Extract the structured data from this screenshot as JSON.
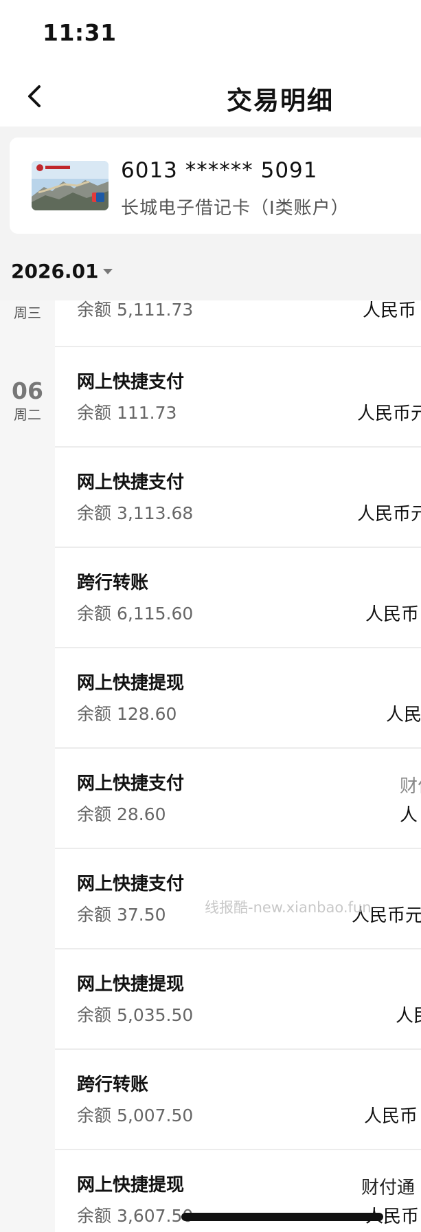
{
  "status_bar": {
    "time": "11:31"
  },
  "nav": {
    "title": "交易明细",
    "back_icon": "chevron-left-icon"
  },
  "account": {
    "card_number": "6013 ****** 5091",
    "card_desc": "长城电子借记卡（I类账户）",
    "card_image": "bank-card-thumbnail"
  },
  "filter": {
    "month": "2026.01"
  },
  "days": [
    {
      "weekday": "周三"
    },
    {
      "day": "06",
      "weekday": "周二"
    }
  ],
  "transactions": [
    {
      "title": "",
      "balance_label": "余额",
      "balance": "5,111.73",
      "right": "人民币"
    },
    {
      "title": "网上快捷支付",
      "balance_label": "余额",
      "balance": "111.73",
      "right": "人民币元"
    },
    {
      "title": "网上快捷支付",
      "balance_label": "余额",
      "balance": "3,113.68",
      "right": "人民币元"
    },
    {
      "title": "跨行转账",
      "balance_label": "余额",
      "balance": "6,115.60",
      "right": "人民币"
    },
    {
      "title": "网上快捷提现",
      "balance_label": "余额",
      "balance": "128.60",
      "right": "人民"
    },
    {
      "title": "网上快捷支付",
      "balance_label": "余额",
      "balance": "28.60",
      "right_top": "财付",
      "right": "人"
    },
    {
      "title": "网上快捷支付",
      "balance_label": "余额",
      "balance": "37.50",
      "right": "人民币元"
    },
    {
      "title": "网上快捷提现",
      "balance_label": "余额",
      "balance": "5,035.50",
      "right": "人民"
    },
    {
      "title": "跨行转账",
      "balance_label": "余额",
      "balance": "5,007.50",
      "right": "人民币"
    },
    {
      "title": "网上快捷提现",
      "balance_label": "余额",
      "balance": "3,607.50",
      "right_top": "财付通",
      "right": "人民币"
    }
  ],
  "watermark": "线报酷-new.xianbao.fun"
}
